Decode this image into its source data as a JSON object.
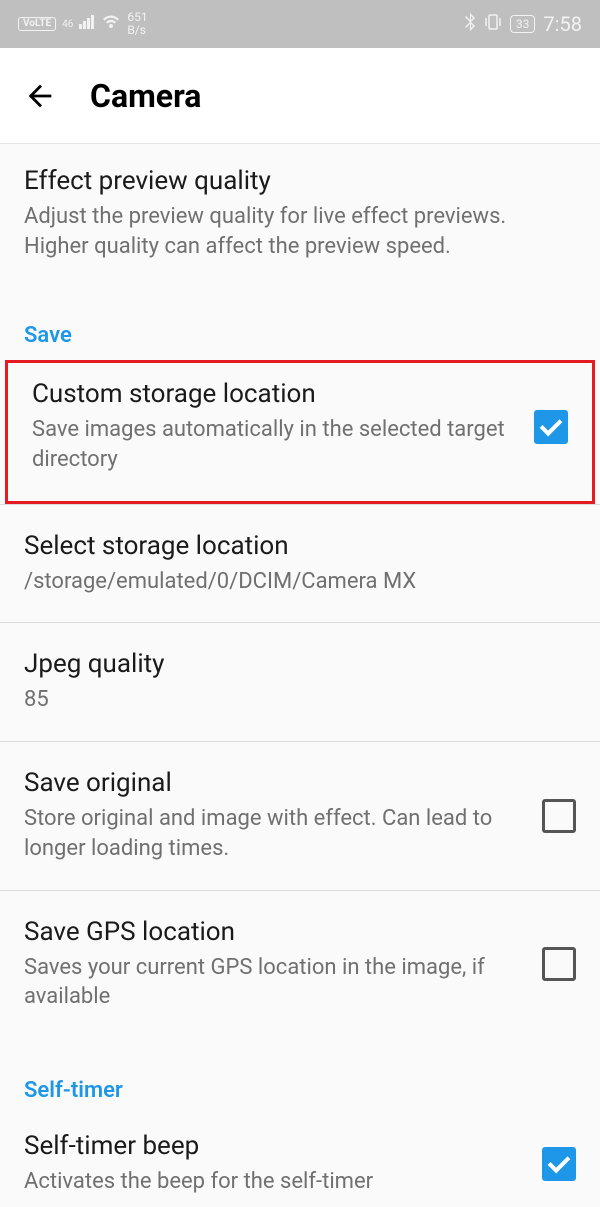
{
  "status": {
    "volte": "VoLTE",
    "net_indicator": "46",
    "speed_top": "651",
    "speed_bot": "B/s",
    "battery": "33",
    "time": "7:58"
  },
  "header": {
    "title": "Camera"
  },
  "items": {
    "effect_preview": {
      "title": "Effect preview quality",
      "desc": "Adjust the preview quality for live effect previews. Higher quality can affect the preview speed."
    }
  },
  "sections": {
    "save": "Save",
    "self_timer": "Self-timer"
  },
  "custom_storage": {
    "title": "Custom storage location",
    "desc": "Save images automatically in the selected target directory"
  },
  "select_storage": {
    "title": "Select storage location",
    "desc": "/storage/emulated/0/DCIM/Camera MX"
  },
  "jpeg_quality": {
    "title": "Jpeg quality",
    "value": "85"
  },
  "save_original": {
    "title": "Save original",
    "desc": "Store original and image with effect. Can lead to longer loading times."
  },
  "save_gps": {
    "title": "Save GPS location",
    "desc": "Saves your current GPS location in the image, if available"
  },
  "self_timer_beep": {
    "title": "Self-timer beep",
    "desc": "Activates the beep for the self-timer"
  }
}
